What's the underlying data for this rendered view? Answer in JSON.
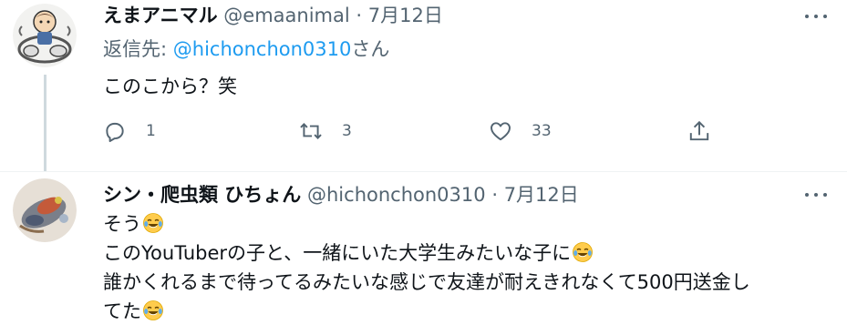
{
  "tweets": [
    {
      "display_name": "えまアニマル",
      "handle": "@emaanimal",
      "date": "7月12日",
      "replying_prefix": "返信先: ",
      "replying_to": "@hichonchon0310",
      "replying_suffix": "さん",
      "text_lines": [
        "このこから？笑"
      ],
      "actions": {
        "reply_count": "1",
        "retweet_count": "3",
        "like_count": "33"
      },
      "icons": [
        "more-icon",
        "reply-icon",
        "retweet-icon",
        "like-icon",
        "share-icon"
      ]
    },
    {
      "display_name": "シン・爬虫類 ひちょん",
      "handle": "@hichonchon0310",
      "date": "7月12日",
      "text_lines": [
        "そう😂",
        "このYouTuberの子と、一緒にいた大学生みたいな子に😂",
        "誰かくれるまで待ってるみたいな感じで友達が耐えきれなくて500円送金し",
        "てた😂"
      ],
      "icons": [
        "more-icon"
      ]
    }
  ],
  "separator_dot": "·",
  "colors": {
    "text": "#0f1419",
    "secondary": "#536471",
    "link": "#1d9bf0",
    "thread_line": "#cfd9de"
  }
}
